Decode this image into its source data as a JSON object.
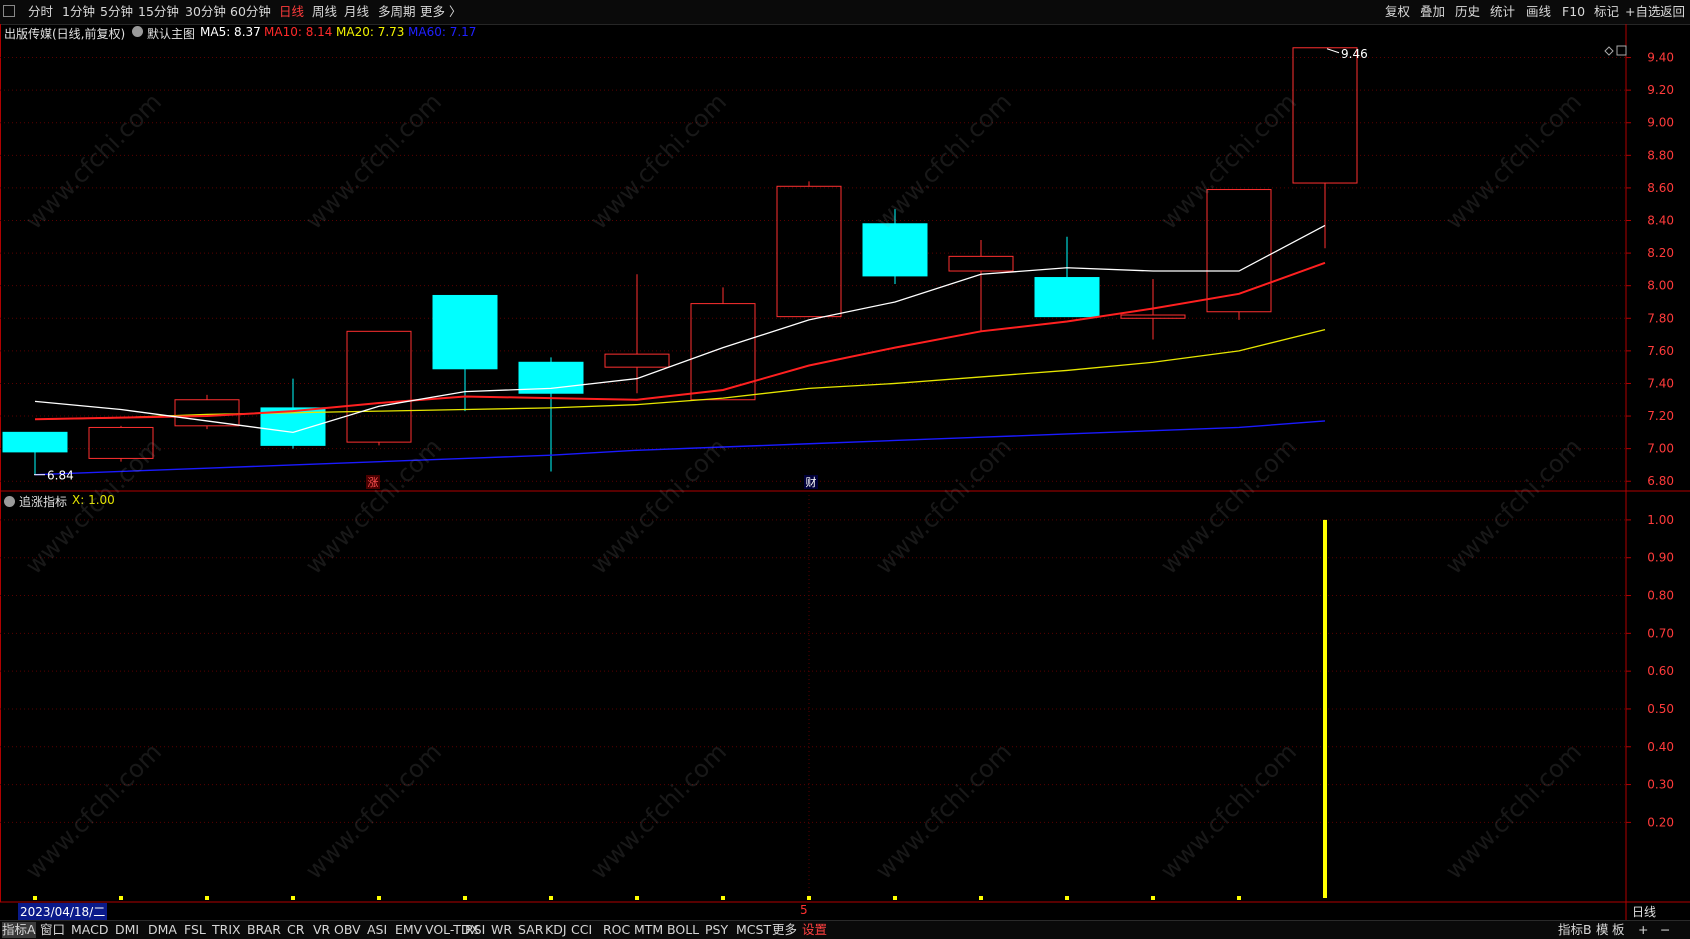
{
  "toolbar": {
    "periods": [
      "分时",
      "1分钟",
      "5分钟",
      "15分钟",
      "30分钟",
      "60分钟",
      "日线",
      "周线",
      "月线",
      "多周期",
      "更多 〉"
    ],
    "active_period": "日线",
    "right_actions": [
      "复权",
      "叠加",
      "历史",
      "统计",
      "画线",
      "F10",
      "标记",
      "+自选",
      "返回"
    ]
  },
  "main_panel": {
    "stock_title": "出版传媒(日线,前复权)",
    "indicator_name": "默认主图",
    "ma_labels": [
      {
        "text": "MA5: 8.37",
        "color": "#ffffff"
      },
      {
        "text": "MA10: 8.14",
        "color": "#ff2a2a"
      },
      {
        "text": "MA20: 7.73",
        "color": "#f2f200"
      },
      {
        "text": "MA60: 7.17",
        "color": "#2020ff"
      }
    ],
    "high_label": "9.46",
    "low_label": "6.84",
    "markers": [
      "涨",
      "财"
    ],
    "y_ticks": [
      "9.40",
      "9.20",
      "9.00",
      "8.80",
      "8.60",
      "8.40",
      "8.20",
      "8.00",
      "7.80",
      "7.60",
      "7.40",
      "7.20",
      "7.00",
      "6.80"
    ]
  },
  "sub_panel": {
    "indicator_name": "追涨指标",
    "value_label": "X: 1.00",
    "y_ticks": [
      "1.00",
      "0.90",
      "0.80",
      "0.70",
      "0.60",
      "0.50",
      "0.40",
      "0.30",
      "0.20"
    ]
  },
  "date_label": "2023/04/18/二",
  "date_marker": "5",
  "period_label": "日线",
  "bottom_tabs": [
    "指标A",
    "窗口",
    "MACD",
    "DMI",
    "DMA",
    "FSL",
    "TRIX",
    "BRAR",
    "CR",
    "VR",
    "OBV",
    "ASI",
    "EMV",
    "VOL-TDX",
    "RSI",
    "WR",
    "SAR",
    "KDJ",
    "CCI",
    "ROC",
    "MTM",
    "BOLL",
    "PSY",
    "MCST",
    "更多",
    "设置"
  ],
  "bottom_right": [
    "指标B",
    "模",
    "板",
    "+",
    "−"
  ],
  "watermark": "www.cfchi.com",
  "colors": {
    "up": "#ff3030",
    "down": "#00ffff",
    "ma5": "#ffffff",
    "ma10": "#ff2020",
    "ma20": "#e6e600",
    "ma60": "#1a1aff",
    "axis": "#b00000",
    "indicator_bar": "#ffff00"
  },
  "chart_data": {
    "type": "candlestick",
    "y_range": [
      6.74,
      9.52
    ],
    "candles": [
      {
        "o": 7.1,
        "c": 6.98,
        "h": 7.1,
        "l": 6.84
      },
      {
        "o": 6.94,
        "c": 7.13,
        "h": 7.14,
        "l": 6.92
      },
      {
        "o": 7.14,
        "c": 7.3,
        "h": 7.33,
        "l": 7.12
      },
      {
        "o": 7.25,
        "c": 7.02,
        "h": 7.43,
        "l": 7.0
      },
      {
        "o": 7.04,
        "c": 7.72,
        "h": 7.72,
        "l": 7.02
      },
      {
        "o": 7.94,
        "c": 7.49,
        "h": 7.94,
        "l": 7.23
      },
      {
        "o": 7.53,
        "c": 7.34,
        "h": 7.56,
        "l": 6.86
      },
      {
        "o": 7.5,
        "c": 7.58,
        "h": 8.07,
        "l": 7.34
      },
      {
        "o": 7.3,
        "c": 7.89,
        "h": 7.99,
        "l": 7.3
      },
      {
        "o": 7.81,
        "c": 8.61,
        "h": 8.64,
        "l": 7.81
      },
      {
        "o": 8.38,
        "c": 8.06,
        "h": 8.47,
        "l": 8.01
      },
      {
        "o": 8.09,
        "c": 8.18,
        "h": 8.28,
        "l": 7.72
      },
      {
        "o": 8.05,
        "c": 7.81,
        "h": 8.3,
        "l": 7.81
      },
      {
        "o": 7.8,
        "c": 7.82,
        "h": 8.04,
        "l": 7.67
      },
      {
        "o": 7.84,
        "c": 8.59,
        "h": 8.59,
        "l": 7.79
      },
      {
        "o": 8.63,
        "c": 9.46,
        "h": 9.46,
        "l": 8.23
      }
    ],
    "ma5": [
      7.29,
      7.24,
      7.17,
      7.1,
      7.26,
      7.35,
      7.37,
      7.43,
      7.62,
      7.79,
      7.9,
      8.07,
      8.11,
      8.09,
      8.09,
      8.37
    ],
    "ma10": [
      7.18,
      7.19,
      7.2,
      7.23,
      7.28,
      7.32,
      7.31,
      7.3,
      7.36,
      7.51,
      7.62,
      7.72,
      7.78,
      7.86,
      7.95,
      8.14
    ],
    "ma20": [
      7.18,
      7.19,
      7.21,
      7.22,
      7.23,
      7.24,
      7.25,
      7.27,
      7.31,
      7.37,
      7.4,
      7.44,
      7.48,
      7.53,
      7.6,
      7.73
    ],
    "ma60": [
      6.84,
      6.86,
      6.88,
      6.9,
      6.92,
      6.94,
      6.96,
      6.99,
      7.01,
      7.03,
      7.05,
      7.07,
      7.09,
      7.11,
      7.13,
      7.17
    ],
    "indicator": {
      "name": "追涨指标",
      "y_range": [
        0,
        1.05
      ],
      "values": [
        0,
        0,
        0,
        0,
        0,
        0,
        0,
        0,
        0,
        0,
        0,
        0,
        0,
        0,
        0,
        1.0
      ]
    }
  }
}
